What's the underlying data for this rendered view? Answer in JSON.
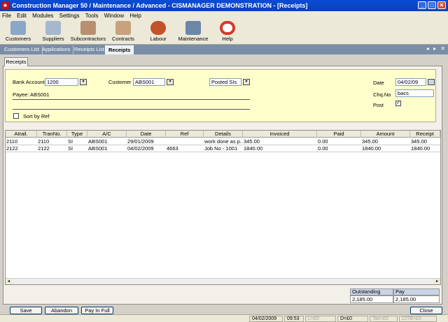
{
  "window": {
    "title": "Construction Manager 50 / Maintenance / Advanced  -  CISMANAGER  DEMONSTRATION - [Receipts]",
    "app_icon_glyph": "♣",
    "minimize": "_",
    "maximize": "□",
    "close": "✕"
  },
  "menu": [
    "File",
    "Edit",
    "Modules",
    "Settings",
    "Tools",
    "Window",
    "Help"
  ],
  "toolbar": {
    "items": [
      {
        "label": "Customers",
        "icon": "customers-icon",
        "color": "#8aa6c8"
      },
      {
        "label": "Suppliers",
        "icon": "suppliers-icon",
        "color": "#a7b7cf"
      },
      {
        "label": "Subcontractors",
        "icon": "subcontractors-icon",
        "color": "#b89070"
      },
      {
        "label": "Contracts",
        "icon": "contracts-icon",
        "color": "#c7a27c"
      },
      {
        "label": "Labour",
        "icon": "labour-icon",
        "color": "#c4522a"
      },
      {
        "label": "Maintenance",
        "icon": "maintenance-icon",
        "color": "#6d86a8"
      },
      {
        "label": "Help",
        "icon": "help-icon",
        "color": "#d23b2b"
      }
    ]
  },
  "tabs": [
    {
      "label": "Customers List",
      "active": false
    },
    {
      "label": "Applications",
      "active": false
    },
    {
      "label": "Receipts List",
      "active": false
    },
    {
      "label": "Receipts",
      "active": true
    }
  ],
  "tab_arrows": "◂ ▸ ✕",
  "subtab": "Receipts",
  "form": {
    "bank_account_label": "Bank Account",
    "bank_account_value": "1200",
    "customer_label": "Customer",
    "customer_value": "ABS001",
    "filter_value": "Posted SIs",
    "payee": "Payee: ABS001",
    "sort_by_ref_label": "Sort by Ref",
    "date_label": "Date",
    "date_value": "04/02/09",
    "chq_label": "Chq.No",
    "chq_value": "bacs",
    "post_label": "Post",
    "post_checked": "✓",
    "dropdown_glyph": "▾"
  },
  "grid": {
    "columns": [
      "Atrail.",
      "TranNo.",
      "Type",
      "A/C",
      "Date",
      "Ref",
      "Details",
      "Invoiced",
      "Paid",
      "Amount",
      "Receipt"
    ],
    "rows": [
      [
        "2110",
        "2110",
        "SI",
        "ABS001",
        "29/01/2009",
        "",
        "work done as p...",
        "345.00",
        "0.00",
        "345.00",
        "345.00"
      ],
      [
        "2122",
        "2122",
        "SI",
        "ABS001",
        "04/02/2009",
        "4663",
        "Job No - 1001",
        "1840.00",
        "0.00",
        "1840.00",
        "1840.00"
      ]
    ],
    "scroll_left": "◂",
    "scroll_right": "▸"
  },
  "totals": {
    "outstanding_label": "Outstanding",
    "outstanding_value": "2,185.00",
    "pay_label": "Pay",
    "pay_value": "2,185.00"
  },
  "buttons": {
    "save": "Save",
    "abandon": "Abandon",
    "pay_in_full": "Pay In Full",
    "close": "Close"
  },
  "status": {
    "date": "04/02/2009",
    "time": "09:53",
    "l": "L=£0",
    "d": "D=£0",
    "tax": "Tax=£0",
    "citb": "CITB=£0"
  }
}
